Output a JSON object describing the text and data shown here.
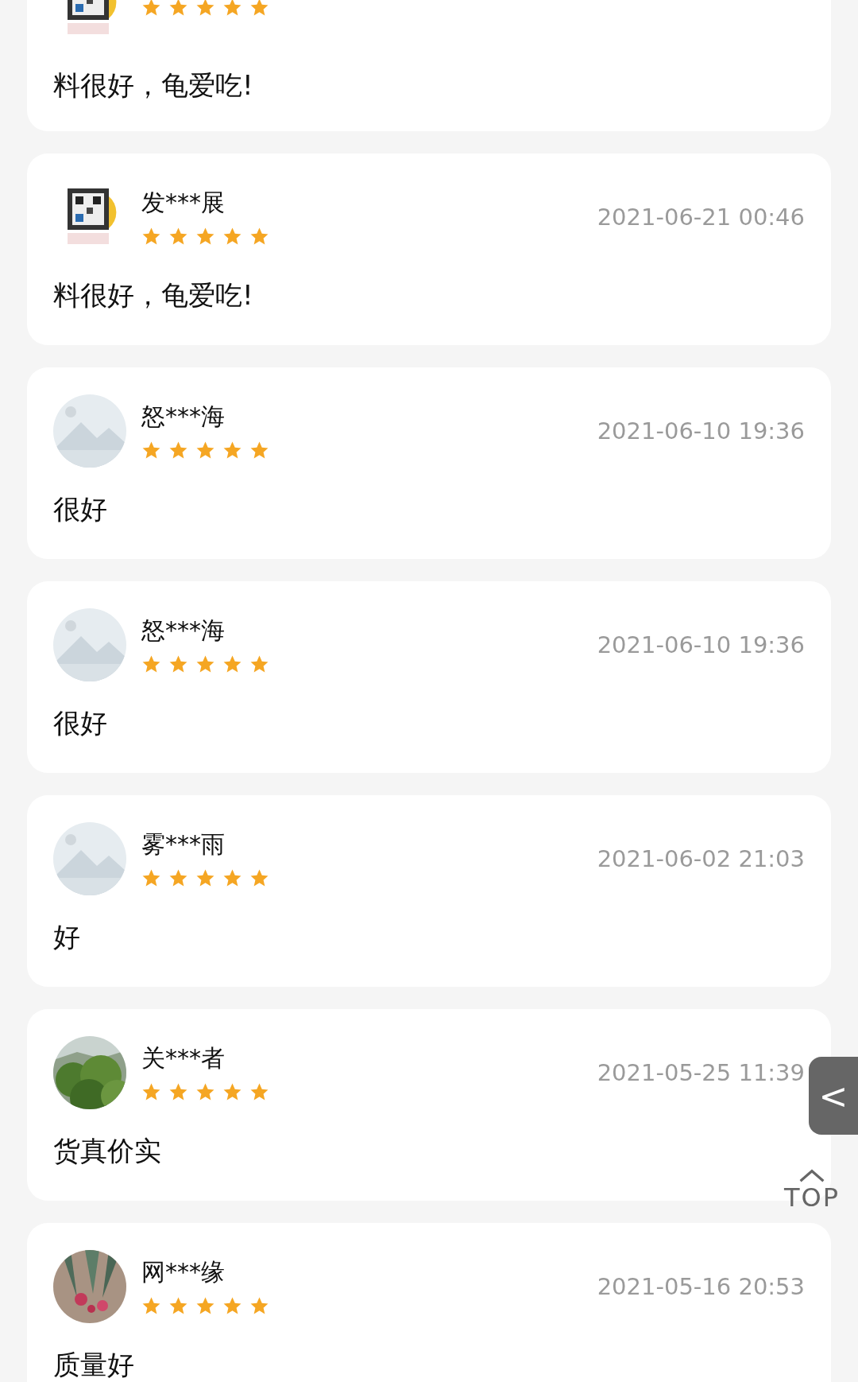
{
  "reviews": [
    {
      "stars": 5,
      "comment": "料很好，龟爱吃!"
    },
    {
      "name": "发***展",
      "date": "2021-06-21 00:46",
      "stars": 5,
      "comment": "料很好，龟爱吃!"
    },
    {
      "name": "怒***海",
      "date": "2021-06-10 19:36",
      "stars": 5,
      "comment": "很好"
    },
    {
      "name": "怒***海",
      "date": "2021-06-10 19:36",
      "stars": 5,
      "comment": "很好"
    },
    {
      "name": "雾***雨",
      "date": "2021-06-02 21:03",
      "stars": 5,
      "comment": "好"
    },
    {
      "name": "关***者",
      "date": "2021-05-25 11:39",
      "stars": 5,
      "comment": "货真价实"
    },
    {
      "name": "网***缘",
      "date": "2021-05-16 20:53",
      "stars": 5,
      "comment": "质量好"
    }
  ],
  "back_tab": {
    "icon": "<"
  },
  "top_button": {
    "label": "TOP"
  }
}
